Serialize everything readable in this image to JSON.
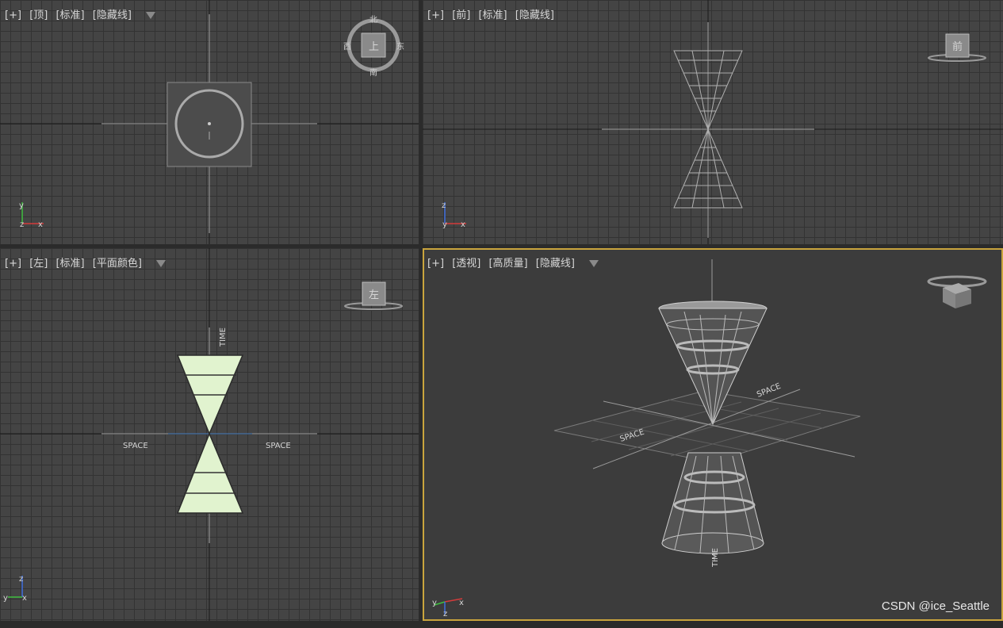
{
  "viewports": [
    {
      "id": "top",
      "label": {
        "plus": "[+]",
        "view": "[顶]",
        "shading": "[标准]",
        "mode": "[隐藏线]"
      },
      "compass": {
        "north": "北",
        "south": "南",
        "east": "东",
        "west": "西",
        "face": "上"
      }
    },
    {
      "id": "front",
      "label": {
        "plus": "[+]",
        "view": "[前]",
        "shading": "[标准]",
        "mode": "[隐藏线]"
      },
      "cube_face": "前"
    },
    {
      "id": "left",
      "label": {
        "plus": "[+]",
        "view": "[左]",
        "shading": "[标准]",
        "mode": "[平面颜色]"
      },
      "cube_face": "左",
      "annotations": {
        "time": "TIME",
        "space_left": "SPACE",
        "space_right": "SPACE"
      }
    },
    {
      "id": "perspective",
      "label": {
        "plus": "[+]",
        "view": "[透视]",
        "shading": "[高质量]",
        "mode": "[隐藏线]"
      },
      "annotations": {
        "space_a": "SPACE",
        "space_b": "SPACE",
        "time": "TIME"
      }
    }
  ],
  "axes": {
    "x": "x",
    "y": "y",
    "z": "z"
  },
  "colors": {
    "x_axis": "#d43b3b",
    "y_axis": "#3fbf3f",
    "z_axis": "#3f6fe0",
    "active_border": "#c9a43d",
    "cone_fill": "#e1f3cf"
  },
  "watermark": "CSDN @ice_Seattle",
  "icons": {
    "filter": "filter-icon"
  }
}
